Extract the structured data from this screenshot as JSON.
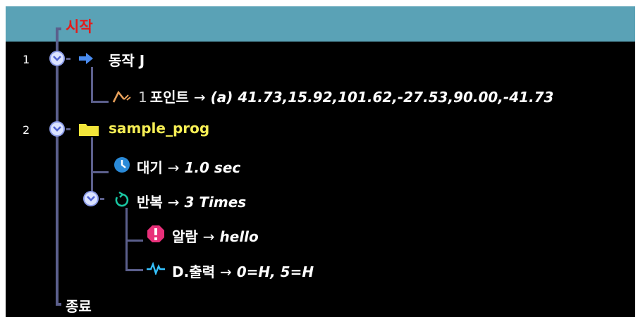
{
  "start_label": "시작",
  "end_label": "종료",
  "line_numbers": [
    "1",
    "2"
  ],
  "arrow_glyph": "→",
  "rows": {
    "move": {
      "label": "동작 J",
      "icon": "arrow-right-icon"
    },
    "point": {
      "prefix": "1",
      "label": "포인트",
      "value": "(a) 41.73,15.92,101.62,-27.53,90.00,-41.73",
      "icon": "waypoint-icon"
    },
    "folder": {
      "label": "sample_prog",
      "icon": "folder-icon"
    },
    "wait": {
      "label": "대기",
      "value": "1.0 sec",
      "icon": "clock-icon"
    },
    "loop": {
      "label": "반복",
      "value": "3 Times",
      "icon": "repeat-icon"
    },
    "alarm": {
      "label": "알람",
      "value": "hello",
      "icon": "alert-icon"
    },
    "output": {
      "label": "D.출력",
      "value": "0=H, 5=H",
      "icon": "signal-icon"
    }
  },
  "colors": {
    "header": "#5aa2b6",
    "start": "#e41b1b",
    "folder": "#f7ef55",
    "tree_line": "#5b5f8c",
    "move_icon": "#4a8cf0",
    "clock": "#2a8ad8",
    "loop": "#19c7a3",
    "alarm": "#e8307a",
    "signal": "#35c2ff",
    "waypoint": "#e8a05a"
  }
}
